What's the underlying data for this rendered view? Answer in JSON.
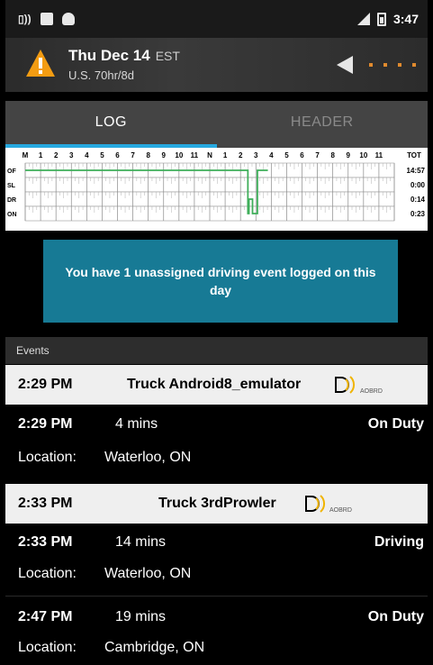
{
  "status_bar": {
    "time": "3:47"
  },
  "header": {
    "date": "Thu Dec 14",
    "timezone": "EST",
    "ruleset": "U.S. 70hr/8d"
  },
  "tabs": [
    {
      "label": "LOG",
      "active": true
    },
    {
      "label": "HEADER",
      "active": false
    }
  ],
  "log_grid": {
    "hour_labels": [
      "M",
      "1",
      "2",
      "3",
      "4",
      "5",
      "6",
      "7",
      "8",
      "9",
      "10",
      "11",
      "N",
      "1",
      "2",
      "3",
      "4",
      "5",
      "6",
      "7",
      "8",
      "9",
      "10",
      "11"
    ],
    "total_label": "TOT",
    "rows": [
      {
        "status": "OF",
        "total": "14:57"
      },
      {
        "status": "SL",
        "total": "0:00"
      },
      {
        "status": "DR",
        "total": "0:14"
      },
      {
        "status": "ON",
        "total": "0:23"
      }
    ],
    "line_color": "#3fae5a",
    "duty_segments": [
      {
        "status": "OF",
        "start_hour": 0,
        "end_hour": 14.48
      },
      {
        "status": "ON",
        "start_hour": 14.48,
        "end_hour": 14.55
      },
      {
        "status": "DR",
        "start_hour": 14.55,
        "end_hour": 14.78
      },
      {
        "status": "ON",
        "start_hour": 14.78,
        "end_hour": 15.1
      },
      {
        "status": "OF",
        "start_hour": 15.1,
        "end_hour": 15.78
      }
    ]
  },
  "notice": {
    "text": "You have 1 unassigned driving event logged on this day",
    "color": "#177a95"
  },
  "events_header": "Events",
  "events": [
    {
      "type": "truck",
      "time": "2:29 PM",
      "name": "Truck Android8_emulator",
      "badge": "AOBRD"
    },
    {
      "type": "event",
      "time": "2:29 PM",
      "duration": "4 mins",
      "status": "On Duty",
      "location_label": "Location:",
      "location": "Waterloo, ON"
    },
    {
      "type": "truck",
      "time": "2:33 PM",
      "name": "Truck 3rdProwler",
      "badge": "AOBRD"
    },
    {
      "type": "event",
      "time": "2:33 PM",
      "duration": "14 mins",
      "status": "Driving",
      "location_label": "Location:",
      "location": "Waterloo, ON"
    },
    {
      "type": "event",
      "time": "2:47 PM",
      "duration": "19 mins",
      "status": "On Duty",
      "location_label": "Location:",
      "location": "Cambridge, ON"
    }
  ],
  "colors": {
    "accent_tab": "#26a9e0",
    "warning": "#f39c12",
    "obd_icon": "#f0b400",
    "status_orange_dots": "#e08a2e"
  }
}
